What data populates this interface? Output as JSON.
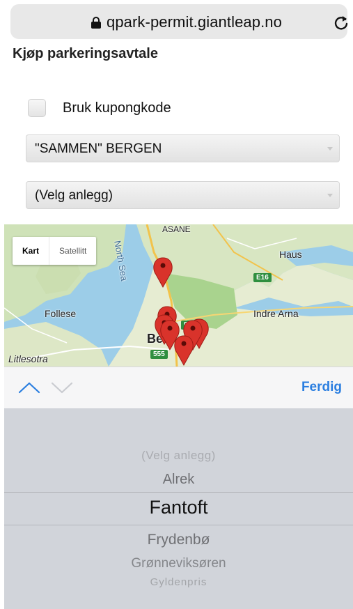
{
  "browser": {
    "url": "qpark-permit.giantleap.no"
  },
  "page": {
    "heading": "Kjøp parkeringsavtale"
  },
  "coupon": {
    "label": "Bruk kupongkode",
    "checked": false
  },
  "selects": {
    "city": "\"SAMMEN\" BERGEN",
    "facility": "(Velg anlegg)"
  },
  "map": {
    "type_control": {
      "map": "Kart",
      "satellite": "Satellitt"
    },
    "labels": {
      "asane": "ASANE",
      "north_sea": "North Sea",
      "haus": "Haus",
      "follese": "Follese",
      "indre_arna": "Indre Arna",
      "bergen_partial": "Be",
      "litlesotra": "Litlesotra"
    },
    "road_badges": {
      "e16": "E16",
      "r555": "555",
      "r585": "585"
    }
  },
  "toolbar": {
    "done": "Ferdig"
  },
  "picker": {
    "options": [
      "(Velg anlegg)",
      "Alrek",
      "Fantoft",
      "Frydenbø",
      "Grønneviksøren",
      "Gyldenpris"
    ],
    "selected": "Fantoft"
  },
  "colors": {
    "accent": "#2a7ee0",
    "pin": "#d9332b",
    "picker_bg": "#d1d4da"
  }
}
